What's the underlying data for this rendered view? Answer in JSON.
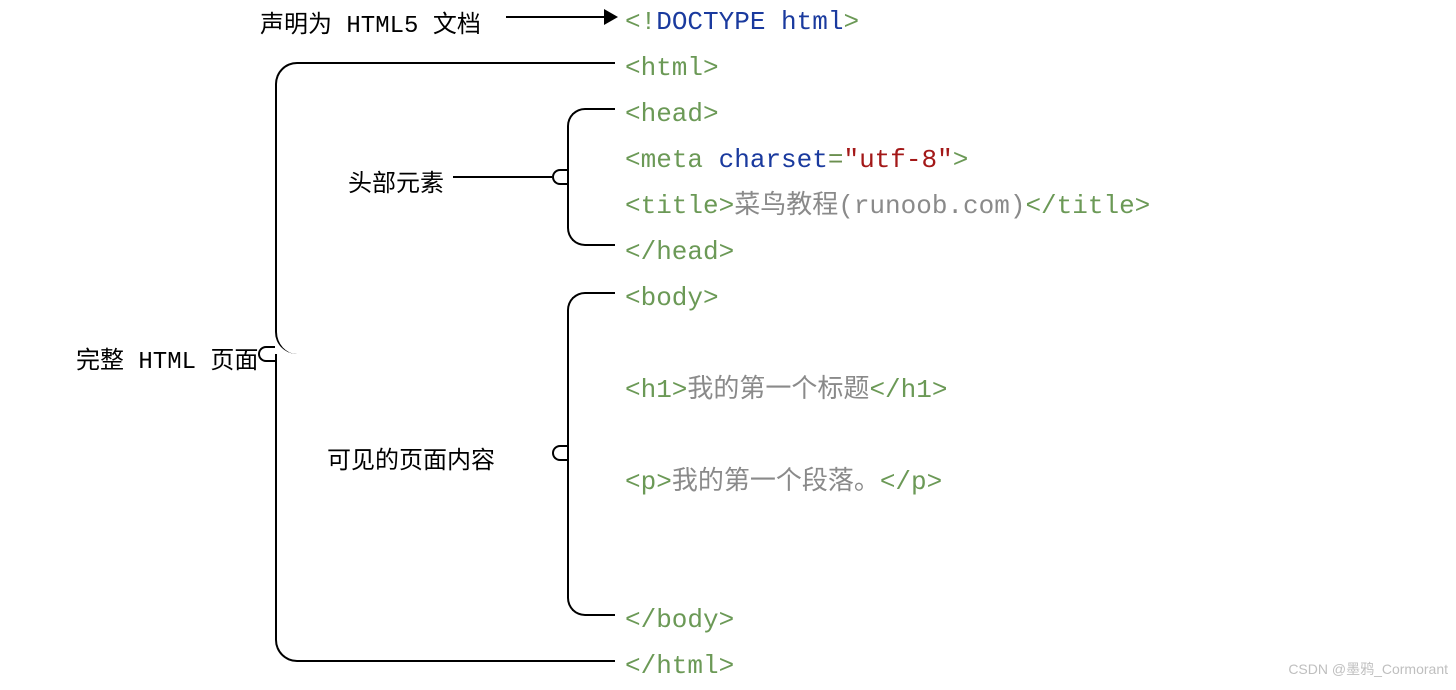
{
  "annotations": {
    "doctype_label": "声明为 HTML5 文档",
    "full_page_label": "完整 HTML 页面",
    "head_label": "头部元素",
    "body_label": "可见的页面内容"
  },
  "code": {
    "doctype_open": "<!",
    "doctype_kw": "DOCTYPE",
    "doctype_space": " ",
    "doctype_name": "html",
    "doctype_close": ">",
    "html_open": "<html>",
    "head_open": "<head>",
    "meta_open": "<",
    "meta_tag": "meta",
    "meta_sp": " ",
    "meta_attr": "charset",
    "meta_eq": "=",
    "meta_val": "\"utf-8\"",
    "meta_close": ">",
    "title_open": "<title>",
    "title_text": "菜鸟教程(runoob.com)",
    "title_close": "</title>",
    "head_close": "</head>",
    "body_open": "<body>",
    "h1_open": "<h1>",
    "h1_text": "我的第一个标题",
    "h1_close": "</h1>",
    "p_open": "<p>",
    "p_text": "我的第一个段落。",
    "p_close": "</p>",
    "body_close": "</body>",
    "html_close": "</html>"
  },
  "watermark": "CSDN @墨鸦_Cormorant"
}
